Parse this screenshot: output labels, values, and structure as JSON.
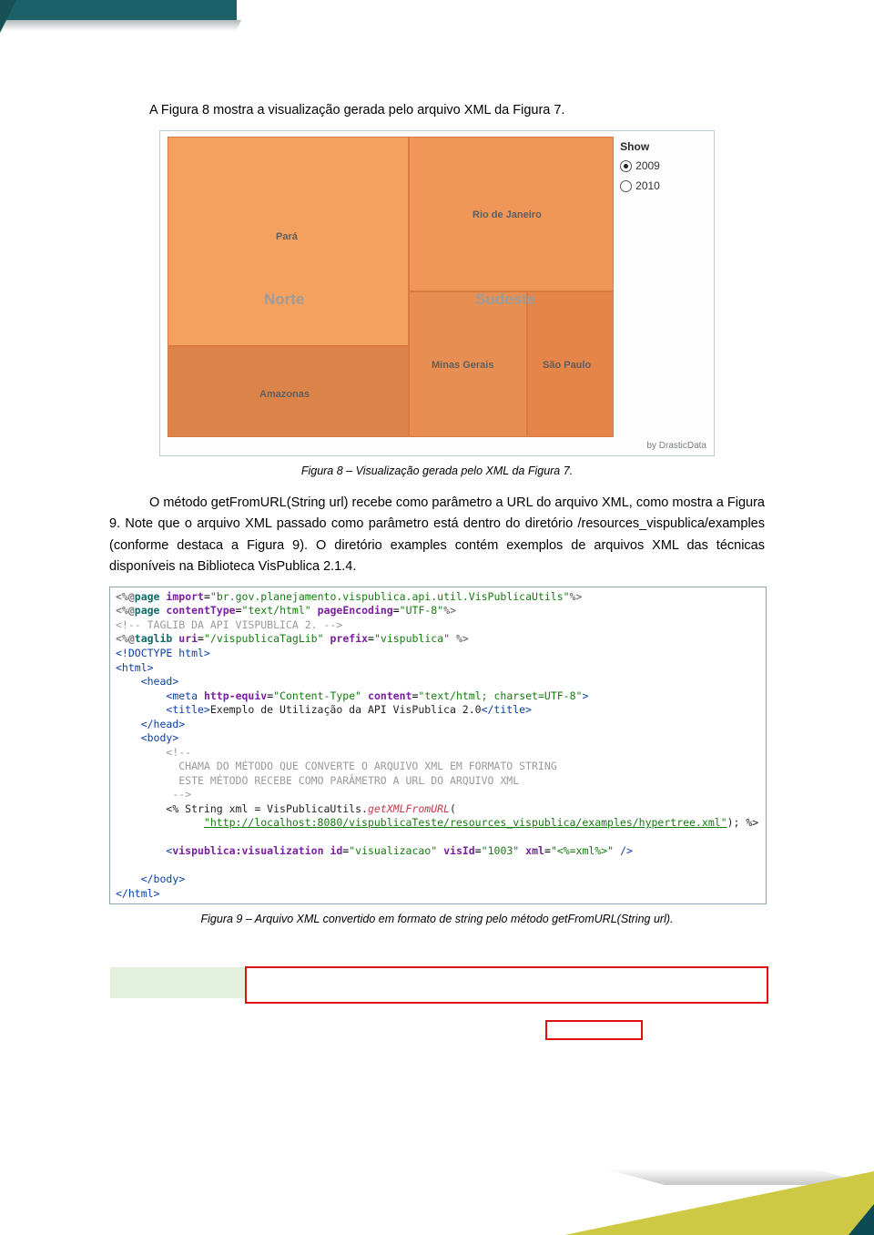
{
  "paragraphs": {
    "p1": "A Figura 8 mostra a visualização gerada pelo arquivo XML da Figura 7.",
    "cap8": "Figura 8 – Visualização gerada pelo XML da Figura 7.",
    "p2": "O método getFromURL(String url) recebe como parâmetro a URL do arquivo XML, como mostra a Figura 9. Note que o arquivo XML passado como parâmetro está dentro do diretório /resources_vispublica/examples (conforme destaca a Figura 9). O diretório examples contém exemplos de arquivos XML das técnicas disponíveis na Biblioteca VisPublica 2.1.4.",
    "cap9": "Figura 9 – Arquivo XML convertido em formato de string pelo método getFromURL(String url)."
  },
  "fig8": {
    "show_label": "Show",
    "opt_2009": "2009",
    "opt_2010": "2010",
    "credit": "by DrasticData",
    "regions": {
      "norte": "Norte",
      "sudeste": "Sudeste"
    },
    "states": {
      "para": "Pará",
      "amazonas": "Amazonas",
      "rio": "Rio de Janeiro",
      "minas": "Minas Gerais",
      "sp": "São Paulo"
    },
    "colors": {
      "para": "#f4a15f",
      "amazonas": "#dc8349",
      "rio": "#ef9759",
      "minas": "#e78f52",
      "sp": "#e5854a",
      "border": "#d87b43"
    }
  },
  "fig9": {
    "l": [
      "<%@",
      "page",
      " import",
      "=",
      "\"br.gov.planejamento.vispublica.api.util.VisPublicaUtils\"",
      "%>"
    ],
    "l2_ct": "\"text/html\"",
    "l2_pe": "\"UTF-8\"",
    "cm1": "<!-- TAGLIB DA API VISPUBLICA 2. -->",
    "uri": "\"/vispublicaTagLib\"",
    "prefix": "\"vispublica\"",
    "doctype": "<!DOCTYPE html>",
    "meta_he": "\"Content-Type\"",
    "meta_ct": "\"text/html; charset=UTF-8\"",
    "title_txt": "Exemplo de Utilização da API VisPublica 2.0",
    "cm2a": "CHAMA DO MÉTODO QUE CONVERTE O ARQUIVO XML EM FORMATO STRING",
    "cm2b": "ESTE MÉTODO RECEBE COMO PARÂMETRO A URL DO ARQUIVO XML",
    "call_pre": "<% String xml = VisPublicaUtils.",
    "call_fn": "getXMLFromURL",
    "call_open": "(",
    "call_url": "\"http://localhost:8080/vispublicaTeste/resources_vispublica/examples/hypertree.xml\"",
    "call_end": "); %>",
    "vis_id": "\"visualizacao\"",
    "vis_visId": "\"1003\"",
    "vis_xml": "\"<%=xml%>\""
  }
}
